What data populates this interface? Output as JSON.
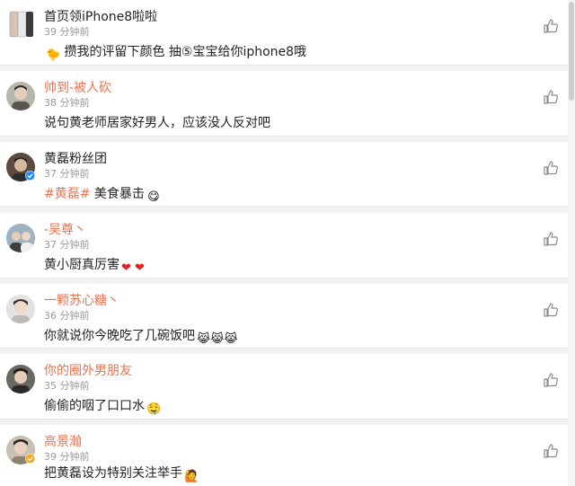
{
  "comments": [
    {
      "name": "首页领iPhone8啦啦",
      "time": "39 分钟前",
      "content": "攒我的评留下颜色  抽⑤宝宝给你iphone8哦",
      "emoji": "",
      "lead_emoji": "chick"
    },
    {
      "name": "帅到-被人砍",
      "time": "38 分钟前",
      "content": "说句黄老师居家好男人，应该没人反对吧",
      "emoji": ""
    },
    {
      "name": "黄磊粉丝团",
      "time": "37 分钟前",
      "topic": "#黄磊#",
      "content": "  美食暴击",
      "emoji": "😋"
    },
    {
      "name": "-吴尊丶",
      "time": "37 分钟前",
      "content": "黄小厨真厉害",
      "emoji": "❤ ❤"
    },
    {
      "name": "一颗苏心糖丶",
      "time": "36 分钟前",
      "content": "你就说你今晚吃了几碗饭吧",
      "emoji": "😹😹😹"
    },
    {
      "name": "你的圈外男朋友",
      "time": "35 分钟前",
      "content": "偷偷的咽了口口水",
      "emoji": "🤤"
    },
    {
      "name": "高景瀚",
      "time": "39 分钟前",
      "content": "把黄磊设为特别关注举手",
      "emoji": "🙋"
    }
  ],
  "colors": {
    "accent": "#eb7350",
    "text": "#222222",
    "muted": "#999999",
    "verified": "#1e90ff"
  },
  "icons": {
    "like": "thumb-up-icon",
    "verified": "verified-badge-icon"
  }
}
